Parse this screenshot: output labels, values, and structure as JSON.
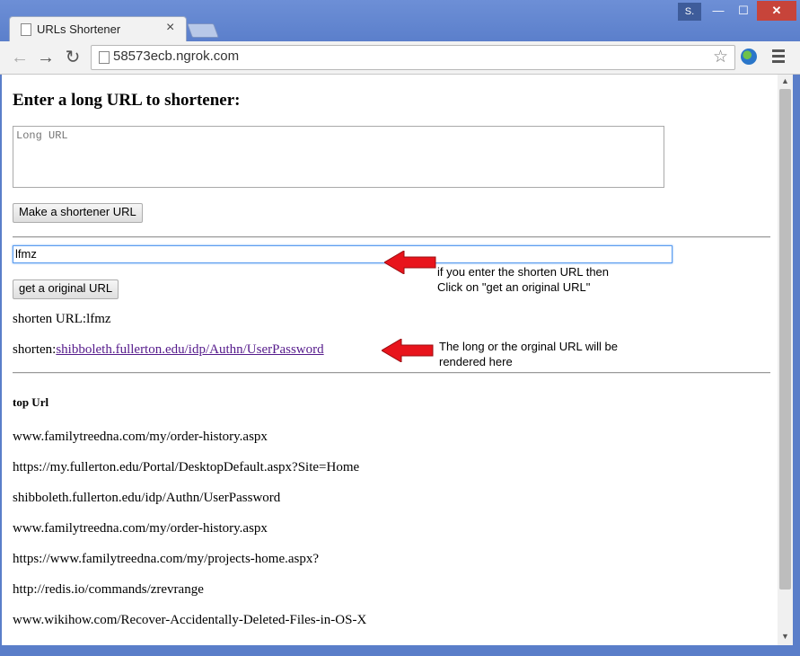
{
  "browser": {
    "tab_title": "URLs Shortener",
    "tab_close": "×",
    "user_badge": "S.",
    "minimize_glyph": "—",
    "maximize_glyph": "☐",
    "close_glyph": "✕",
    "back_glyph": "←",
    "forward_glyph": "→",
    "reload_glyph": "↻",
    "address": "58573ecb.ngrok.com",
    "star_glyph": "☆",
    "scroll_up_glyph": "▲",
    "scroll_down_glyph": "▼"
  },
  "page": {
    "heading": "Enter a long URL to shortener:",
    "long_url_placeholder": "Long URL",
    "shorten_button": "Make a shortener URL",
    "short_input_value": "lfmz",
    "original_button": "get a original URL",
    "shorten_url_line": "shorten URL:lfmz",
    "shorten_prefix": "shorten:",
    "shorten_link": "shibboleth.fullerton.edu/idp/Authn/UserPassword",
    "top_heading": "top Url",
    "top_urls": [
      "www.familytreedna.com/my/order-history.aspx",
      "https://my.fullerton.edu/Portal/DesktopDefault.aspx?Site=Home",
      "shibboleth.fullerton.edu/idp/Authn/UserPassword",
      "www.familytreedna.com/my/order-history.aspx",
      "https://www.familytreedna.com/my/projects-home.aspx?",
      "http://redis.io/commands/zrevrange",
      "www.wikihow.com/Recover-Accidentally-Deleted-Files-in-OS-X"
    ]
  },
  "annotations": {
    "note1_line1": "if you enter the shorten URL then",
    "note1_line2": "Click on \"get an original URL\"",
    "note2_line1": "The long or the orginal URL will be",
    "note2_line2": "rendered here",
    "arrow_color": "#e8141c"
  },
  "colors": {
    "window_frame": "#5a7ec9",
    "close_button": "#c7443a",
    "link": "#551a8b",
    "input_focus": "#5c9df0"
  }
}
